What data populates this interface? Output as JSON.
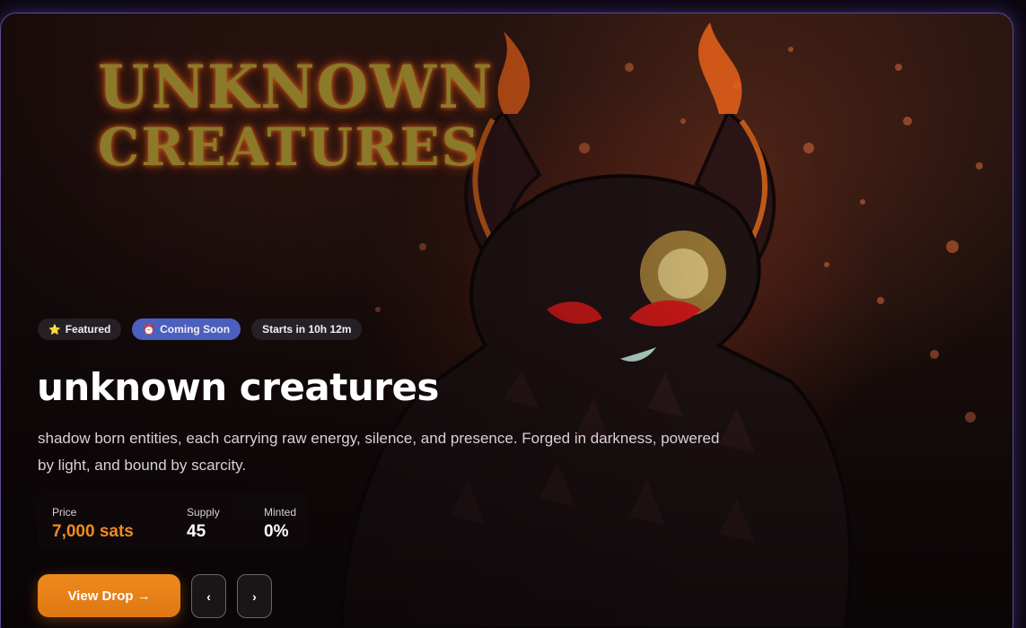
{
  "hero": {
    "art_title_line1": "UNKNOWN",
    "art_title_line2": "CREATURES",
    "badges": {
      "featured": {
        "icon": "star-icon",
        "glyph": "⭐",
        "label": "Featured"
      },
      "coming_soon": {
        "icon": "alarm-clock-icon",
        "glyph": "⏰",
        "label": "Coming Soon"
      },
      "starts_in": {
        "label": "Starts in 10h 12m"
      }
    },
    "title": "unknown creatures",
    "description": "shadow born entities, each carrying raw energy, silence, and presence. Forged in darkness, powered by light, and bound by scarcity.",
    "stats": {
      "price": {
        "label": "Price",
        "value": "7,000 sats"
      },
      "supply": {
        "label": "Supply",
        "value": "45"
      },
      "minted": {
        "label": "Minted",
        "value": "0%"
      }
    },
    "actions": {
      "view_drop": "View Drop",
      "view_drop_arrow": "→",
      "prev": "‹",
      "next": "›"
    }
  },
  "colors": {
    "accent": "#f08a1e",
    "coming_soon_badge": "#4b5fbf",
    "card_border": "#5d4a9a"
  }
}
